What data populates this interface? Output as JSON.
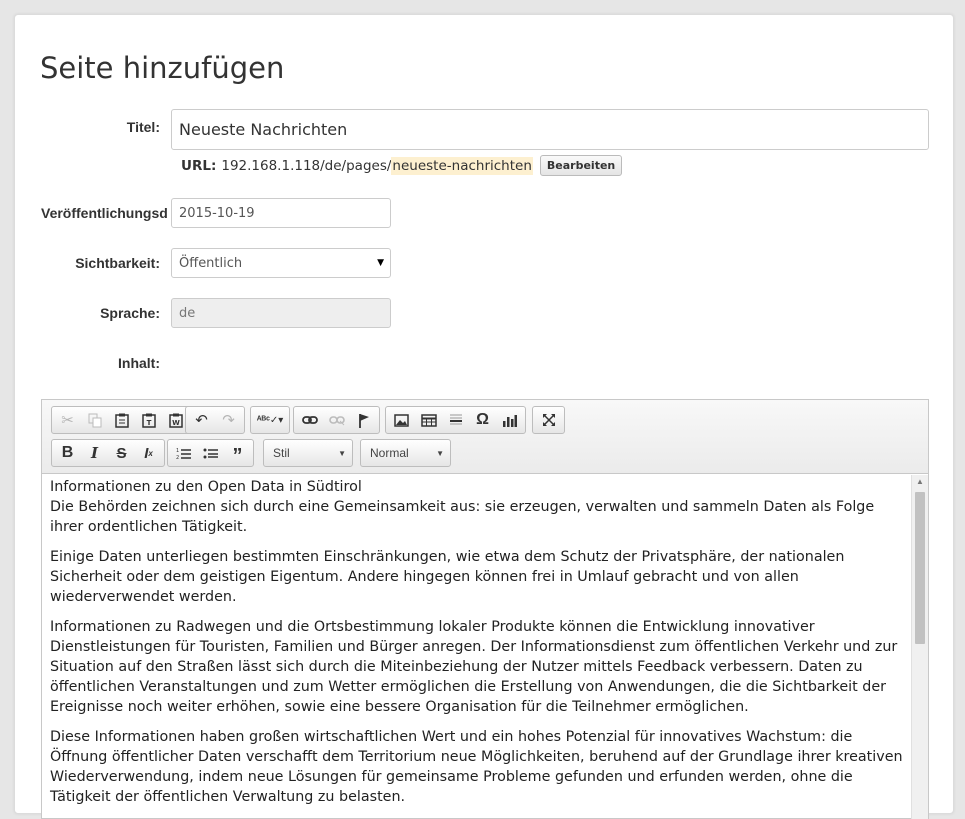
{
  "page": {
    "title": "Seite hinzufügen"
  },
  "form": {
    "title_label": "Titel:",
    "title_value": "Neueste Nachrichten",
    "url_label": "URL:",
    "url_base": "192.168.1.118/de/pages/",
    "url_slug": "neueste-nachrichten",
    "edit_button": "Bearbeiten",
    "date_label": "Veröffentlichungsd",
    "date_value": "2015-10-19",
    "visibility_label": "Sichtbarkeit:",
    "visibility_value": "Öffentlich",
    "language_label": "Sprache:",
    "language_value": "de",
    "content_label": "Inhalt:"
  },
  "editor": {
    "style_combo": "Stil",
    "format_combo": "Normal",
    "icons": [
      "cut-icon",
      "copy-icon",
      "paste-icon",
      "paste-text-icon",
      "paste-word-icon",
      "undo-icon",
      "redo-icon",
      "spellcheck-icon",
      "link-icon",
      "unlink-icon",
      "anchor-icon",
      "image-icon",
      "table-icon",
      "horizontal-rule-icon",
      "special-char-icon",
      "chart-icon",
      "maximize-icon",
      "bold-icon",
      "italic-icon",
      "strike-icon",
      "remove-format-icon",
      "numbered-list-icon",
      "bulleted-list-icon",
      "blockquote-icon"
    ],
    "content": {
      "heading_line": "Informationen zu den Open Data in Südtirol",
      "p1": "Die Behörden zeichnen sich durch eine Gemeinsamkeit aus: sie erzeugen, verwalten und sammeln Daten als Folge ihrer ordentlichen Tätigkeit.",
      "p2": "Einige Daten unterliegen bestimmten Einschränkungen, wie etwa dem Schutz der Privatsphäre, der nationalen Sicherheit oder dem geistigen Eigentum. Andere hingegen können frei in Umlauf gebracht und von allen wiederverwendet werden.",
      "p3": "Informationen zu Radwegen und die Ortsbestimmung lokaler Produkte können die Entwicklung innovativer Dienstleistungen für Touristen, Familien und Bürger anregen. Der Informationsdienst zum öffentlichen Verkehr und zur Situation auf den Straßen lässt sich durch die Miteinbeziehung der Nutzer mittels Feedback verbessern. Daten zu öffentlichen Veranstaltungen und zum Wetter ermöglichen die Erstellung von Anwendungen, die die Sichtbarkeit der Ereignisse noch weiter erhöhen, sowie eine bessere Organisation für die Teilnehmer ermöglichen.",
      "p4": "Diese Informationen haben großen wirtschaftlichen Wert und ein hohes Potenzial für innovatives Wachstum: die Öffnung öffentlicher Daten verschafft dem Territorium neue Möglichkeiten, beruhend auf der Grundlage ihrer kreativen Wiederverwendung, indem neue Lösungen für gemeinsame Probleme gefunden und erfunden werden, ohne die Tätigkeit der öffentlichen Verwaltung zu belasten."
    }
  }
}
